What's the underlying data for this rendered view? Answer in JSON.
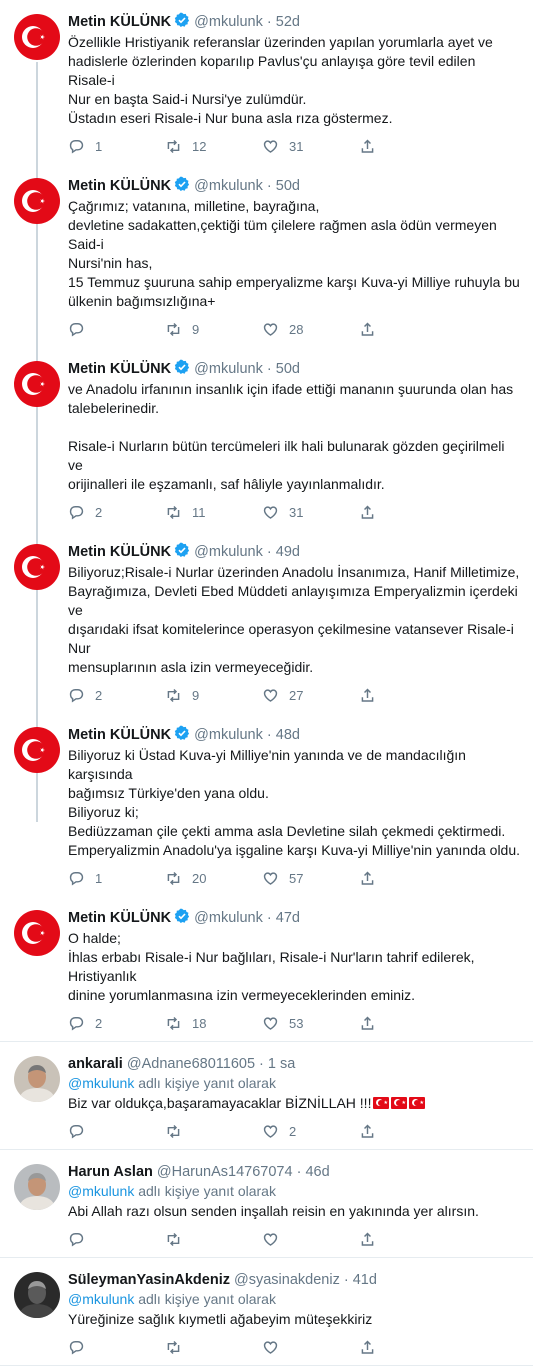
{
  "colors": {
    "accent": "#1b95e0",
    "verified": "#1da1f2",
    "muted": "#657786",
    "flag_red": "#e30a17"
  },
  "tweets": [
    {
      "name": "Metin KÜLÜNK",
      "verified": true,
      "handle": "@mkulunk",
      "time": "52d",
      "lines": [
        "Özellikle Hristiyanik referanslar üzerinden yapılan yorumlarla ayet ve",
        "hadislerle özlerinden koparılıp Pavlus'çu anlayışa göre tevil edilen Risale-i",
        "Nur en başta Said-i Nursi'ye zulümdür.",
        "Üstadın eseri Risale-i Nur buna asla rıza göstermez."
      ],
      "replies": "1",
      "retweets": "12",
      "likes": "31"
    },
    {
      "name": "Metin KÜLÜNK",
      "verified": true,
      "handle": "@mkulunk",
      "time": "50d",
      "lines": [
        "Çağrımız; vatanına, milletine, bayrağına,",
        "devletine sadakatten,çektiği tüm çilelere rağmen asla ödün vermeyen Said-i",
        "Nursi'nin has,",
        "15 Temmuz şuuruna sahip emperyalizme karşı Kuva-yi Milliye ruhuyla bu",
        "ülkenin bağımsızlığına+"
      ],
      "replies": "",
      "retweets": "9",
      "likes": "28"
    },
    {
      "name": "Metin KÜLÜNK",
      "verified": true,
      "handle": "@mkulunk",
      "time": "50d",
      "lines": [
        "ve Anadolu irfanının insanlık için ifade ettiği mananın şuurunda olan has",
        "talebelerinedir.",
        "",
        "Risale-i Nurların bütün tercümeleri ilk hali bulunarak gözden geçirilmeli ve",
        "orijinalleri ile eşzamanlı, saf hâliyle yayınlanmalıdır."
      ],
      "replies": "2",
      "retweets": "11",
      "likes": "31"
    },
    {
      "name": "Metin KÜLÜNK",
      "verified": true,
      "handle": "@mkulunk",
      "time": "49d",
      "lines": [
        "Biliyoruz;Risale-i Nurlar üzerinden Anadolu İnsanımıza, Hanif Milletimize,",
        "Bayrağımıza, Devleti Ebed Müddeti anlayışımıza Emperyalizmin içerdeki ve",
        "dışarıdaki ifsat komitelerince operasyon çekilmesine vatansever Risale-i Nur",
        "mensuplarının asla izin vermeyeceğidir."
      ],
      "replies": "2",
      "retweets": "9",
      "likes": "27"
    },
    {
      "name": "Metin KÜLÜNK",
      "verified": true,
      "handle": "@mkulunk",
      "time": "48d",
      "lines": [
        "Biliyoruz ki Üstad Kuva-yi Milliye'nin yanında ve de mandacılığın karşısında",
        "bağımsız Türkiye'den yana oldu.",
        "Biliyoruz ki;",
        "Bediüzzaman çile çekti amma asla Devletine silah çekmedi çektirmedi.",
        "Emperyalizmin Anadolu'ya işgaline karşı Kuva-yi Milliye'nin yanında oldu."
      ],
      "replies": "1",
      "retweets": "20",
      "likes": "57"
    },
    {
      "name": "Metin KÜLÜNK",
      "verified": true,
      "handle": "@mkulunk",
      "time": "47d",
      "lines": [
        "O halde;",
        "İhlas erbabı Risale-i Nur bağlıları, Risale-i Nur'ların tahrif edilerek, Hristiyanlık",
        "dinine yorumlanmasına izin vermeyeceklerinden eminiz."
      ],
      "replies": "2",
      "retweets": "18",
      "likes": "53"
    }
  ],
  "replies_list": [
    {
      "name": "ankarali",
      "handle": "@Adnane68011605",
      "time": "1 sa",
      "replying_mention": "@mkulunk",
      "replying_suffix": "adlı kişiye yanıt olarak",
      "text": "Biz var oldukça,başaramayacaklar BİZNİLLAH !!!",
      "flags": 3,
      "replies": "",
      "retweets": "",
      "likes": "2"
    },
    {
      "name": "Harun Aslan",
      "handle": "@HarunAs14767074",
      "time": "46d",
      "replying_mention": "@mkulunk",
      "replying_suffix": "adlı kişiye yanıt olarak",
      "text": "Abi Allah razı olsun senden inşallah reisin en yakınında yer alırsın.",
      "flags": 0,
      "replies": "",
      "retweets": "",
      "likes": ""
    },
    {
      "name": "SüleymanYasinAkdeniz",
      "handle": "@syasinakdeniz",
      "time": "41d",
      "replying_mention": "@mkulunk",
      "replying_suffix": "adlı kişiye yanıt olarak",
      "text": "Yüreğinize sağlık kıymetli ağabeyim müteşekkiriz",
      "flags": 0,
      "replies": "",
      "retweets": "",
      "likes": ""
    }
  ]
}
